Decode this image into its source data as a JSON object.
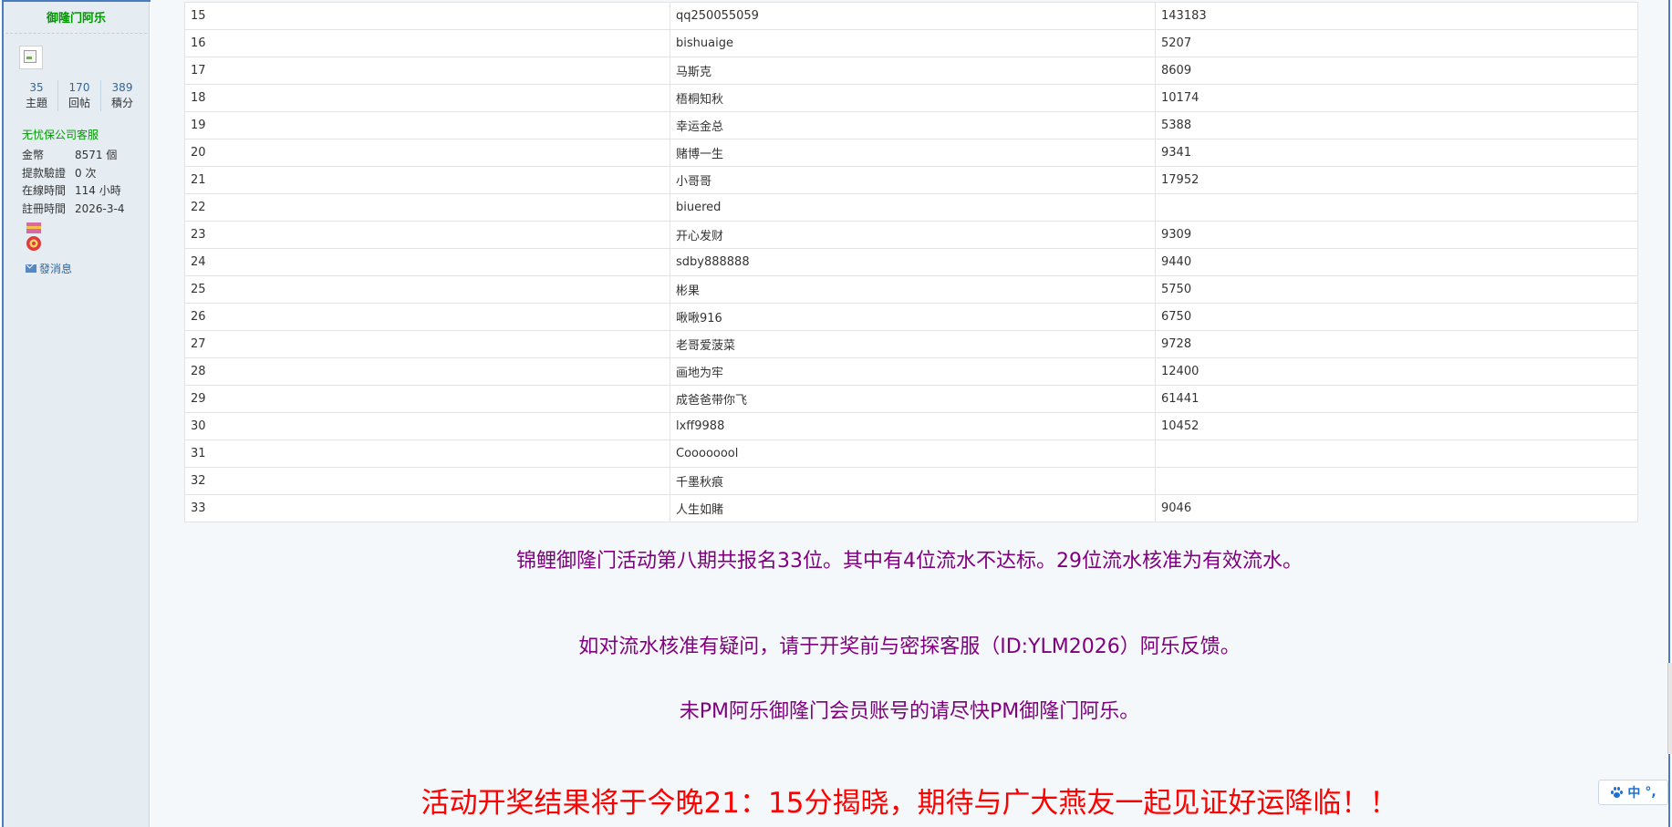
{
  "sidebar": {
    "username": "御隆门阿乐",
    "stats": [
      {
        "num": "35",
        "label": "主題"
      },
      {
        "num": "170",
        "label": "回帖"
      },
      {
        "num": "389",
        "label": "積分"
      }
    ],
    "group": "无忧保公司客服",
    "info": [
      {
        "key": "金幣",
        "value": "8571 個"
      },
      {
        "key": "提款驗證",
        "value": "0 次"
      },
      {
        "key": "在線時間",
        "value": "114 小時"
      },
      {
        "key": "註冊時間",
        "value": "2026-3-4"
      }
    ],
    "pm_label": "發消息"
  },
  "table": {
    "rows": [
      {
        "no": "15",
        "name": "qq250055059",
        "value": "143183"
      },
      {
        "no": "16",
        "name": "bishuaige",
        "value": "5207"
      },
      {
        "no": "17",
        "name": "马斯克",
        "value": "8609"
      },
      {
        "no": "18",
        "name": "梧桐知秋",
        "value": "10174"
      },
      {
        "no": "19",
        "name": "幸运金总",
        "value": "5388"
      },
      {
        "no": "20",
        "name": "赌博一生",
        "value": "9341"
      },
      {
        "no": "21",
        "name": "小哥哥",
        "value": "17952"
      },
      {
        "no": "22",
        "name": "biuered",
        "value": ""
      },
      {
        "no": "23",
        "name": "开心发财",
        "value": "9309"
      },
      {
        "no": "24",
        "name": "sdby888888",
        "value": "9440"
      },
      {
        "no": "25",
        "name": "彬果",
        "value": "5750"
      },
      {
        "no": "26",
        "name": "啾啾916",
        "value": "6750"
      },
      {
        "no": "27",
        "name": "老哥爱菠菜",
        "value": "9728"
      },
      {
        "no": "28",
        "name": "画地为牢",
        "value": "12400"
      },
      {
        "no": "29",
        "name": "成爸爸带你飞",
        "value": "61441"
      },
      {
        "no": "30",
        "name": "lxff9988",
        "value": "10452"
      },
      {
        "no": "31",
        "name": "Coooooool",
        "value": ""
      },
      {
        "no": "32",
        "name": "千墨秋痕",
        "value": ""
      },
      {
        "no": "33",
        "name": "人生如賭",
        "value": "9046"
      }
    ]
  },
  "notices": {
    "line1": "锦鲤御隆门活动第八期共报名33位。其中有4位流水不达标。29位流水核准为有效流水。",
    "line2": "如对流水核准有疑问，请于开奖前与密探客服（ID:YLM2026）阿乐反馈。",
    "line3": "未PM阿乐御隆门会员账号的请尽快PM御隆门阿乐。",
    "line4": "活动开奖结果将于今晚21：15分揭晓，期待与广大燕友一起见证好运降临！！"
  },
  "ime": {
    "mode": "中",
    "punct": "°,"
  },
  "colors": {
    "group": "#009900",
    "notice": "#800080",
    "announce": "#ff0000",
    "link": "#336699"
  }
}
